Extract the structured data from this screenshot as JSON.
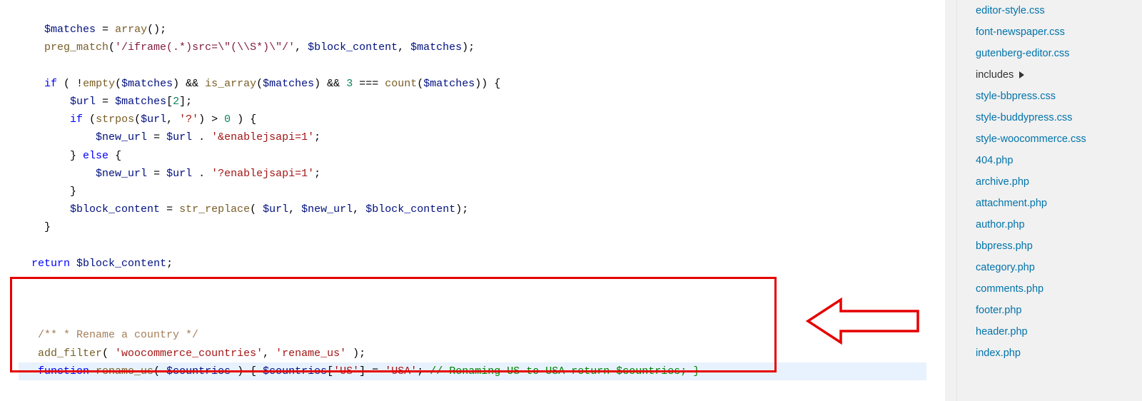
{
  "code": {
    "l1_var1": "$matches",
    "l1_fn": "array",
    "l2_fn": "preg_match",
    "l2_regex": "'/iframe(.*)src=\\\"(\\\\S*)\\\"/'",
    "l2_var1": "$block_content",
    "l2_var2": "$matches",
    "l4_if": "if",
    "l4_fn1": "empty",
    "l4_var1": "$matches",
    "l4_fn2": "is_array",
    "l4_num": "3",
    "l4_fn3": "count",
    "l5_var1": "$url",
    "l5_var2": "$matches",
    "l5_num": "2",
    "l6_if": "if",
    "l6_fn": "strpos",
    "l6_var": "$url",
    "l6_str": "'?'",
    "l6_num": "0",
    "l7_var1": "$new_url",
    "l7_var2": "$url",
    "l7_str": "'&enablejsapi=1'",
    "l8_else": "else",
    "l9_var1": "$new_url",
    "l9_var2": "$url",
    "l9_str": "'?enablejsapi=1'",
    "l11_var1": "$block_content",
    "l11_fn": "str_replace",
    "l11_var2": "$url",
    "l11_var3": "$new_url",
    "l11_var4": "$block_content",
    "l14_kw": "return",
    "l14_var": "$block_content",
    "box_comment": "/** * Rename a country */",
    "box_fn1": "add_filter",
    "box_str1": "'woocommerce_countries'",
    "box_str2": "'rename_us'",
    "box_kw_fn": "function",
    "box_fname": "rename_us",
    "box_var1": "$countries",
    "box_var2": "$countries",
    "box_str3": "'US'",
    "box_str4": "'USA'",
    "box_comment2": "// Renaming US to USA return $countries; }"
  },
  "files": [
    {
      "label": "editor-style.css",
      "type": "file"
    },
    {
      "label": "font-newspaper.css",
      "type": "file"
    },
    {
      "label": "gutenberg-editor.css",
      "type": "file"
    },
    {
      "label": "includes",
      "type": "folder"
    },
    {
      "label": "style-bbpress.css",
      "type": "file"
    },
    {
      "label": "style-buddypress.css",
      "type": "file"
    },
    {
      "label": "style-woocommerce.css",
      "type": "file"
    },
    {
      "label": "404.php",
      "type": "file"
    },
    {
      "label": "archive.php",
      "type": "file"
    },
    {
      "label": "attachment.php",
      "type": "file"
    },
    {
      "label": "author.php",
      "type": "file"
    },
    {
      "label": "bbpress.php",
      "type": "file"
    },
    {
      "label": "category.php",
      "type": "file"
    },
    {
      "label": "comments.php",
      "type": "file"
    },
    {
      "label": "footer.php",
      "type": "file"
    },
    {
      "label": "header.php",
      "type": "file"
    },
    {
      "label": "index.php",
      "type": "file"
    }
  ]
}
